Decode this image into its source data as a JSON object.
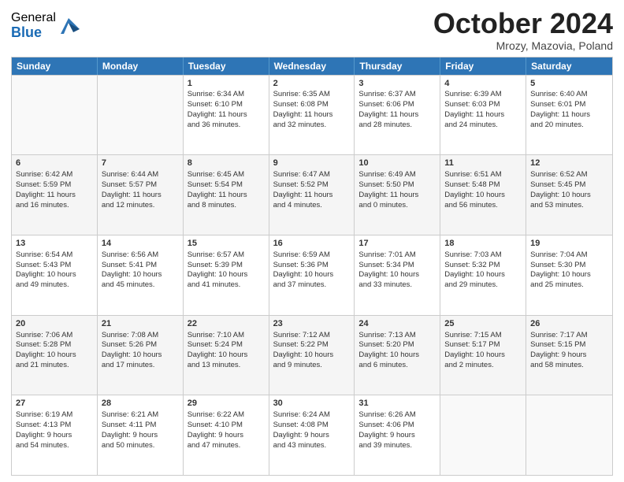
{
  "logo": {
    "general": "General",
    "blue": "Blue"
  },
  "header": {
    "month": "October 2024",
    "location": "Mrozy, Mazovia, Poland"
  },
  "weekdays": [
    "Sunday",
    "Monday",
    "Tuesday",
    "Wednesday",
    "Thursday",
    "Friday",
    "Saturday"
  ],
  "weeks": [
    [
      {
        "day": "",
        "info": ""
      },
      {
        "day": "",
        "info": ""
      },
      {
        "day": "1",
        "info": "Sunrise: 6:34 AM\nSunset: 6:10 PM\nDaylight: 11 hours\nand 36 minutes."
      },
      {
        "day": "2",
        "info": "Sunrise: 6:35 AM\nSunset: 6:08 PM\nDaylight: 11 hours\nand 32 minutes."
      },
      {
        "day": "3",
        "info": "Sunrise: 6:37 AM\nSunset: 6:06 PM\nDaylight: 11 hours\nand 28 minutes."
      },
      {
        "day": "4",
        "info": "Sunrise: 6:39 AM\nSunset: 6:03 PM\nDaylight: 11 hours\nand 24 minutes."
      },
      {
        "day": "5",
        "info": "Sunrise: 6:40 AM\nSunset: 6:01 PM\nDaylight: 11 hours\nand 20 minutes."
      }
    ],
    [
      {
        "day": "6",
        "info": "Sunrise: 6:42 AM\nSunset: 5:59 PM\nDaylight: 11 hours\nand 16 minutes."
      },
      {
        "day": "7",
        "info": "Sunrise: 6:44 AM\nSunset: 5:57 PM\nDaylight: 11 hours\nand 12 minutes."
      },
      {
        "day": "8",
        "info": "Sunrise: 6:45 AM\nSunset: 5:54 PM\nDaylight: 11 hours\nand 8 minutes."
      },
      {
        "day": "9",
        "info": "Sunrise: 6:47 AM\nSunset: 5:52 PM\nDaylight: 11 hours\nand 4 minutes."
      },
      {
        "day": "10",
        "info": "Sunrise: 6:49 AM\nSunset: 5:50 PM\nDaylight: 11 hours\nand 0 minutes."
      },
      {
        "day": "11",
        "info": "Sunrise: 6:51 AM\nSunset: 5:48 PM\nDaylight: 10 hours\nand 56 minutes."
      },
      {
        "day": "12",
        "info": "Sunrise: 6:52 AM\nSunset: 5:45 PM\nDaylight: 10 hours\nand 53 minutes."
      }
    ],
    [
      {
        "day": "13",
        "info": "Sunrise: 6:54 AM\nSunset: 5:43 PM\nDaylight: 10 hours\nand 49 minutes."
      },
      {
        "day": "14",
        "info": "Sunrise: 6:56 AM\nSunset: 5:41 PM\nDaylight: 10 hours\nand 45 minutes."
      },
      {
        "day": "15",
        "info": "Sunrise: 6:57 AM\nSunset: 5:39 PM\nDaylight: 10 hours\nand 41 minutes."
      },
      {
        "day": "16",
        "info": "Sunrise: 6:59 AM\nSunset: 5:36 PM\nDaylight: 10 hours\nand 37 minutes."
      },
      {
        "day": "17",
        "info": "Sunrise: 7:01 AM\nSunset: 5:34 PM\nDaylight: 10 hours\nand 33 minutes."
      },
      {
        "day": "18",
        "info": "Sunrise: 7:03 AM\nSunset: 5:32 PM\nDaylight: 10 hours\nand 29 minutes."
      },
      {
        "day": "19",
        "info": "Sunrise: 7:04 AM\nSunset: 5:30 PM\nDaylight: 10 hours\nand 25 minutes."
      }
    ],
    [
      {
        "day": "20",
        "info": "Sunrise: 7:06 AM\nSunset: 5:28 PM\nDaylight: 10 hours\nand 21 minutes."
      },
      {
        "day": "21",
        "info": "Sunrise: 7:08 AM\nSunset: 5:26 PM\nDaylight: 10 hours\nand 17 minutes."
      },
      {
        "day": "22",
        "info": "Sunrise: 7:10 AM\nSunset: 5:24 PM\nDaylight: 10 hours\nand 13 minutes."
      },
      {
        "day": "23",
        "info": "Sunrise: 7:12 AM\nSunset: 5:22 PM\nDaylight: 10 hours\nand 9 minutes."
      },
      {
        "day": "24",
        "info": "Sunrise: 7:13 AM\nSunset: 5:20 PM\nDaylight: 10 hours\nand 6 minutes."
      },
      {
        "day": "25",
        "info": "Sunrise: 7:15 AM\nSunset: 5:17 PM\nDaylight: 10 hours\nand 2 minutes."
      },
      {
        "day": "26",
        "info": "Sunrise: 7:17 AM\nSunset: 5:15 PM\nDaylight: 9 hours\nand 58 minutes."
      }
    ],
    [
      {
        "day": "27",
        "info": "Sunrise: 6:19 AM\nSunset: 4:13 PM\nDaylight: 9 hours\nand 54 minutes."
      },
      {
        "day": "28",
        "info": "Sunrise: 6:21 AM\nSunset: 4:11 PM\nDaylight: 9 hours\nand 50 minutes."
      },
      {
        "day": "29",
        "info": "Sunrise: 6:22 AM\nSunset: 4:10 PM\nDaylight: 9 hours\nand 47 minutes."
      },
      {
        "day": "30",
        "info": "Sunrise: 6:24 AM\nSunset: 4:08 PM\nDaylight: 9 hours\nand 43 minutes."
      },
      {
        "day": "31",
        "info": "Sunrise: 6:26 AM\nSunset: 4:06 PM\nDaylight: 9 hours\nand 39 minutes."
      },
      {
        "day": "",
        "info": ""
      },
      {
        "day": "",
        "info": ""
      }
    ]
  ]
}
